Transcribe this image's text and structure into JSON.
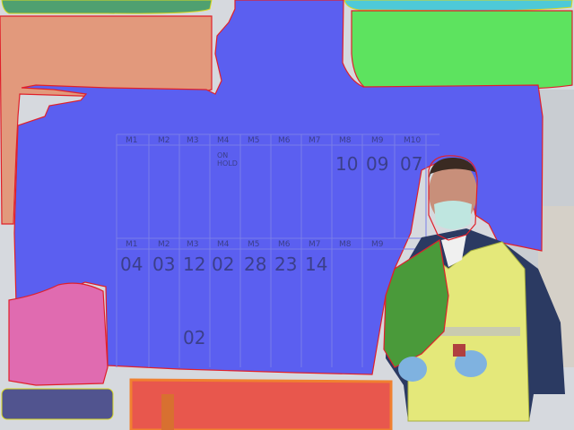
{
  "colors": {
    "background": "#d9dce0",
    "board_overlay": "#5b5ff0",
    "orange_overlay": "#e2997c",
    "green_overlay": "#5de35f",
    "pink_overlay": "#e06bb0",
    "red_overlay": "#e8574d",
    "outline_red": "#e0202a"
  },
  "board": {
    "top_numbers": [
      "10",
      "09",
      "07"
    ],
    "bottom_numbers": [
      "04",
      "03",
      "12",
      "02",
      "28",
      "23",
      "14"
    ],
    "extra_number": "02",
    "header_cells_top": [
      "M1",
      "M2",
      "M3",
      "M4",
      "M5",
      "M6",
      "M7",
      "M8",
      "M9",
      "M10"
    ],
    "header_cells_bottom": [
      "M1",
      "M2",
      "M3",
      "M4",
      "M5",
      "M6",
      "M7",
      "M8",
      "M9"
    ],
    "note_top": "ON\nHOLD"
  },
  "worker": {
    "description": "warehouse worker with high-visibility vest, face mask and blue gloves"
  }
}
